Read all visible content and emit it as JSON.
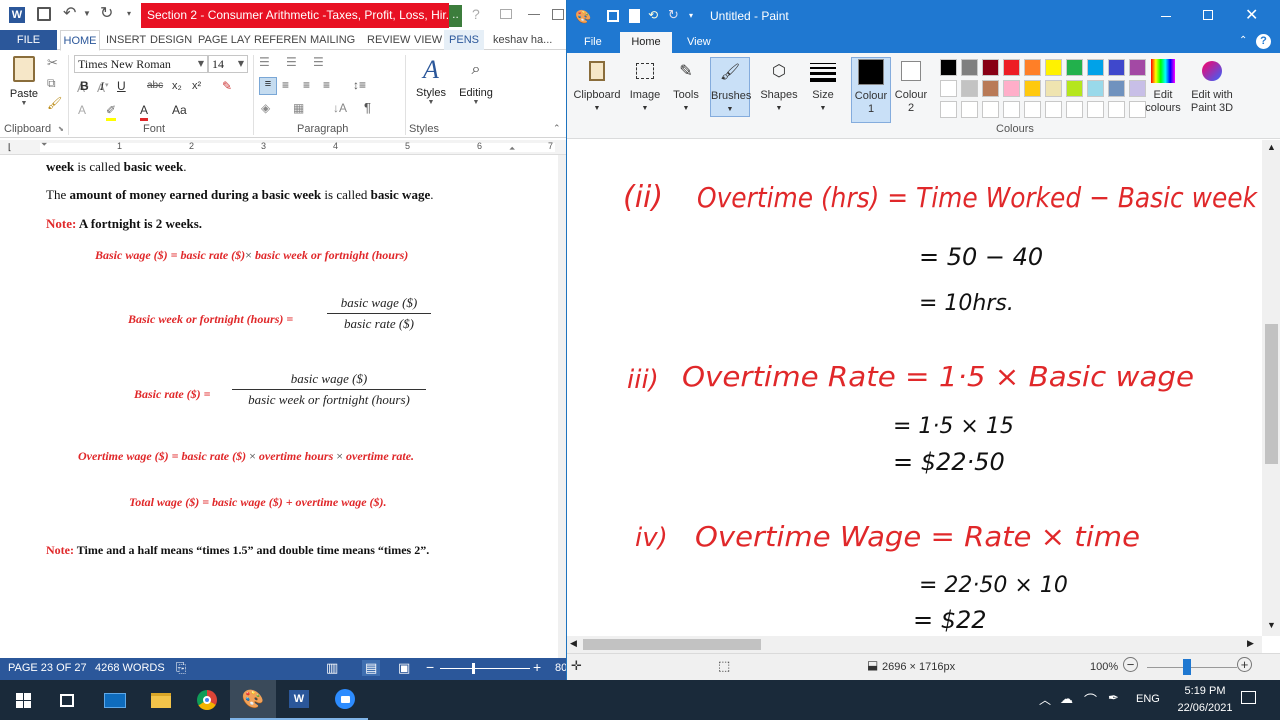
{
  "word": {
    "title": "Section 2 - Consumer Arithmetic -Taxes, Profit, Loss, Hir...",
    "app_icon": "word-icon",
    "tabs": {
      "file": "FILE",
      "home": "HOME",
      "insert": "INSERT",
      "design": "DESIGN",
      "layout": "PAGE LAY",
      "references": "REFEREN",
      "mailings": "MAILING",
      "review": "REVIEW",
      "view": "VIEW",
      "pens": "PENS"
    },
    "user": "keshav ha...",
    "ribbon": {
      "paste": "Paste",
      "clipboard": "Clipboard",
      "font_name": "Times New Roman",
      "font_size": "14",
      "font": "Font",
      "paragraph": "Paragraph",
      "styles": "Styles",
      "editing": "Editing",
      "styles_group": "Styles",
      "bold": "B",
      "italic": "I",
      "underline": "U",
      "strike": "abc",
      "sub": "x₂",
      "sup": "x²",
      "case": "Aa"
    },
    "ruler": [
      "1",
      "2",
      "3",
      "4",
      "5",
      "6",
      "7"
    ],
    "doc": {
      "l1_b1": "week",
      "l1_t": " is called ",
      "l1_b2": "basic week",
      "l2_t1": "The ",
      "l2_b1": "amount of money earned during a basic week",
      "l2_t2": " is called ",
      "l2_b2": "basic wage",
      "l3_note": "Note:",
      "l3_text": " A fortnight is 2 weeks.",
      "f1": "Basic wage ($) = basic rate ($)",
      "f1_times": "×",
      "f1b": " basic week or fortnight (hours)",
      "f2_label": "Basic week or fortnight (hours) =",
      "f2_num": "basic  wage ($)",
      "f2_den": "basic  rate ($)",
      "f3_label": "Basic rate ($) =",
      "f3_num": "basic wage ($)",
      "f3_den": "basic week or fortnight (hours)",
      "f4a": "Overtime wage ($) = basic rate ($)",
      "f4_times1": " × ",
      "f4b": "overtime hours",
      "f4_times2": " × ",
      "f4c": "overtime rate.",
      "f5": "Total wage ($) = basic wage ($) + overtime wage ($).",
      "l8_note": "Note:",
      "l8_text": " Time and a half means “times 1.5” and double time means “times 2”."
    },
    "status": {
      "page": "PAGE 23 OF 27",
      "words": "4268 WORDS",
      "zoom": "80"
    }
  },
  "paint": {
    "title": "Untitled - Paint",
    "tabs": {
      "file": "File",
      "home": "Home",
      "view": "View"
    },
    "tools": {
      "clipboard": "Clipboard",
      "image": "Image",
      "tools": "Tools",
      "brushes": "Brushes",
      "shapes": "Shapes",
      "size": "Size",
      "colour1": "Colour\n1",
      "colour2": "Colour\n2",
      "edit_colours": "Edit\ncolours",
      "paint3d": "Edit with\nPaint 3D",
      "colours_group": "Colours"
    },
    "palette": [
      "#000000",
      "#7f7f7f",
      "#880015",
      "#ed1c24",
      "#ff7f27",
      "#fff200",
      "#22b14c",
      "#00a2e8",
      "#3f48cc",
      "#a349a4",
      "#ffffff",
      "#c3c3c3",
      "#b97a57",
      "#ffaec9",
      "#ffc90e",
      "#efe4b0",
      "#b5e61d",
      "#99d9ea",
      "#7092be",
      "#c8bfe7"
    ],
    "canvas": {
      "ii_label": "(ii)",
      "ii_title": "Overtime (hrs) = Time Worked − Basic week",
      "ii_s1": "= 50 − 40",
      "ii_s2": "= 10hrs.",
      "iii_label": "iii)",
      "iii_title": "Overtime Rate = 1·5 × Basic wage",
      "iii_s1": "= 1·5 ×  15",
      "iii_s2": "= $22·50",
      "iv_label": "iv)",
      "iv_title": "Overtime Wage = Rate × time",
      "iv_s1": "= 22·50 × 10",
      "iv_s2": "= $22"
    },
    "status": {
      "dimensions": "2696 × 1716px",
      "zoom": "100%"
    }
  },
  "taskbar": {
    "lang": "ENG",
    "time": "5:19 PM",
    "date": "22/06/2021"
  }
}
